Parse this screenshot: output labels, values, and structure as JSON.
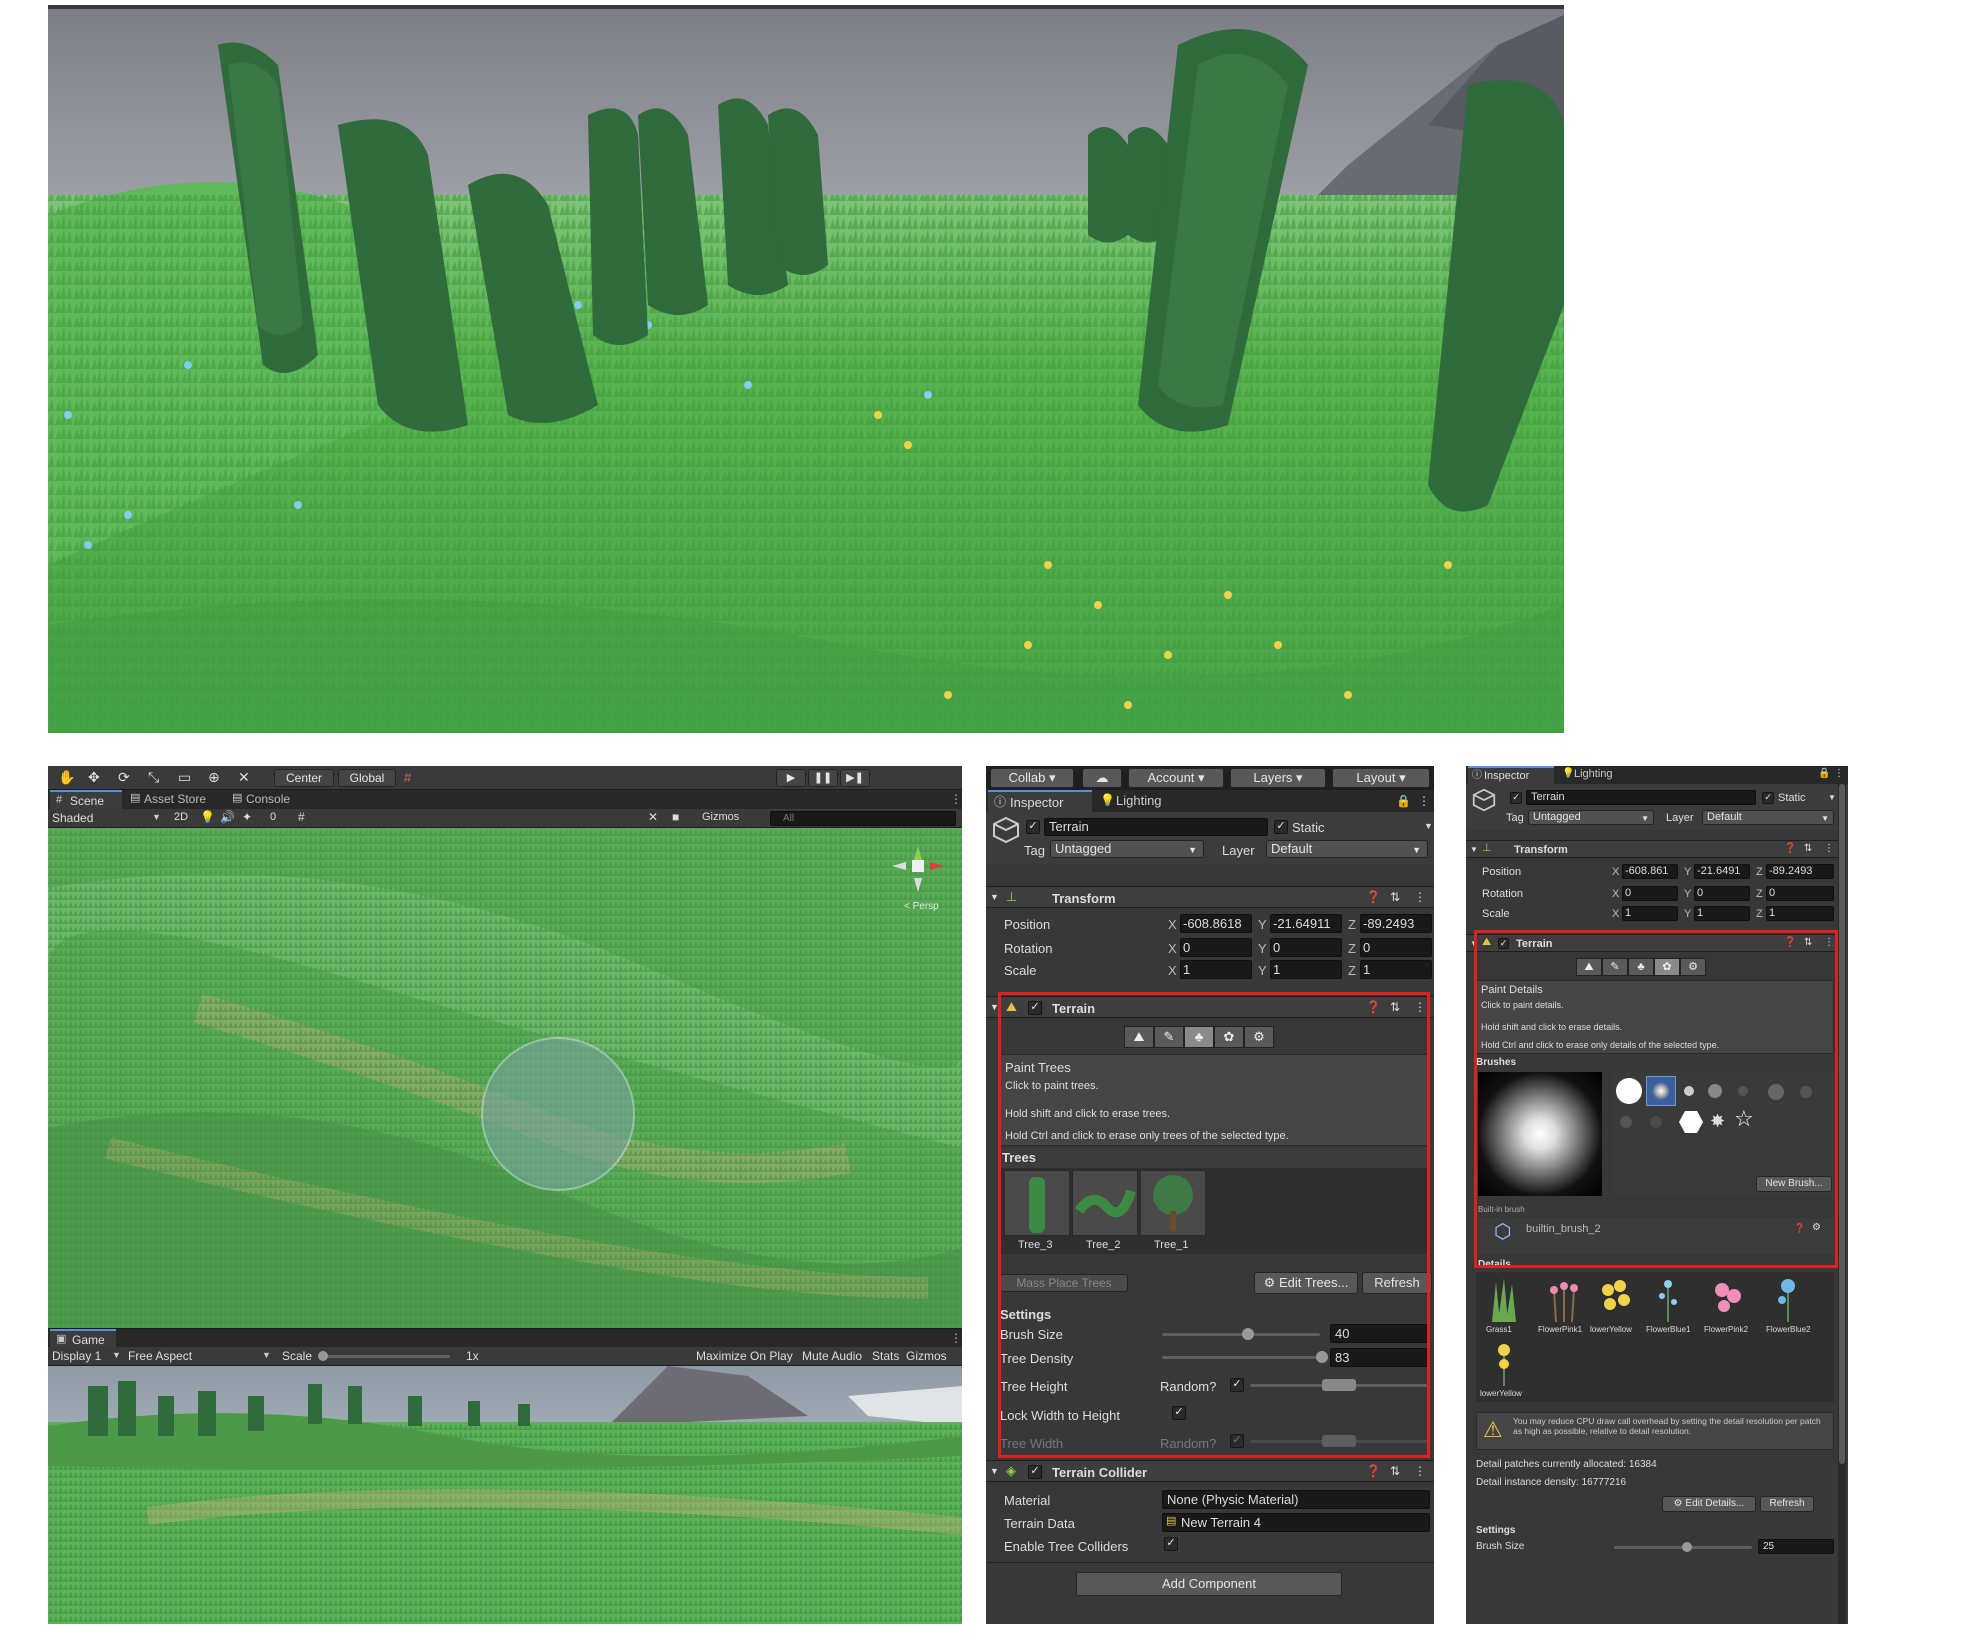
{
  "main_scene": {
    "description_hidden": ""
  },
  "editor": {
    "toolbar": {
      "center": "Center",
      "global": "Global"
    },
    "tabs": {
      "scene": "Scene",
      "asset_store": "Asset Store",
      "console": "Console"
    },
    "scene_bar": {
      "shading": "Shaded",
      "mode_2d": "2D",
      "hidden_count": "0",
      "gizmos": "Gizmos",
      "search_placeholder": "All"
    },
    "gizmo": {
      "persp": "< Persp"
    },
    "game": {
      "tab": "Game",
      "display": "Display 1",
      "aspect": "Free Aspect",
      "scale_label": "Scale",
      "scale_value": "1x",
      "maximize": "Maximize On Play",
      "mute": "Mute Audio",
      "stats": "Stats",
      "gizmos": "Gizmos"
    }
  },
  "inspector1": {
    "topbar": {
      "collab": "Collab",
      "account": "Account",
      "layers": "Layers",
      "layout": "Layout"
    },
    "tabs": {
      "inspector": "Inspector",
      "lighting": "Lighting"
    },
    "object": {
      "name": "Terrain",
      "static": "Static",
      "tag_label": "Tag",
      "tag": "Untagged",
      "layer_label": "Layer",
      "layer": "Default"
    },
    "transform": {
      "title": "Transform",
      "rows": [
        {
          "label": "Position",
          "x": "-608.8618",
          "y": "-21.64911",
          "z": "-89.2493"
        },
        {
          "label": "Rotation",
          "x": "0",
          "y": "0",
          "z": "0"
        },
        {
          "label": "Scale",
          "x": "1",
          "y": "1",
          "z": "1"
        }
      ]
    },
    "terrain": {
      "title": "Terrain",
      "help_title": "Paint Trees",
      "help_lines": [
        "Click to paint trees.",
        "Hold shift and click to erase trees.",
        "Hold Ctrl and click to erase only trees of the selected type."
      ],
      "trees_header": "Trees",
      "trees": [
        "Tree_3",
        "Tree_2",
        "Tree_1"
      ],
      "mass_place": "Mass Place Trees",
      "edit_trees": "Edit Trees...",
      "refresh": "Refresh",
      "settings_header": "Settings",
      "brush_size_label": "Brush Size",
      "brush_size": "40",
      "tree_density_label": "Tree Density",
      "tree_density": "83",
      "tree_height_label": "Tree Height",
      "random_label": "Random?",
      "lock_label": "Lock Width to Height",
      "tree_width_label": "Tree Width"
    },
    "collider": {
      "title": "Terrain Collider",
      "material_label": "Material",
      "material": "None (Physic Material)",
      "data_label": "Terrain Data",
      "data": "New Terrain 4",
      "enable_label": "Enable Tree Colliders"
    },
    "add_component": "Add Component"
  },
  "inspector2": {
    "tabs": {
      "inspector": "Inspector",
      "lighting": "Lighting"
    },
    "object": {
      "name": "Terrain",
      "static": "Static",
      "tag_label": "Tag",
      "tag": "Untagged",
      "layer_label": "Layer",
      "layer": "Default"
    },
    "transform": {
      "title": "Transform",
      "rows": [
        {
          "label": "Position",
          "x": "-608.861",
          "y": "-21.6491",
          "z": "-89.2493"
        },
        {
          "label": "Rotation",
          "x": "0",
          "y": "0",
          "z": "0"
        },
        {
          "label": "Scale",
          "x": "1",
          "y": "1",
          "z": "1"
        }
      ]
    },
    "terrain": {
      "title": "Terrain",
      "help_title": "Paint Details",
      "help_lines": [
        "Click to paint details.",
        "Hold shift and click to erase details.",
        "Hold Ctrl and click to erase only details of the selected type."
      ],
      "brushes_header": "Brushes",
      "new_brush": "New Brush...",
      "builtin_label": "Built-in brush",
      "brush_name": "builtin_brush_2",
      "details_header": "Details",
      "details": [
        "Grass1",
        "FlowerPink1",
        "lowerYellow",
        "FlowerBlue1",
        "FlowerPink2",
        "FlowerBlue2"
      ],
      "details_row2": [
        "lowerYellow"
      ],
      "warning": "You may reduce CPU draw call overhead by setting the detail resolution per patch as high as possible, relative to detail resolution.",
      "patches": "Detail patches currently allocated: 16384",
      "density": "Detail instance density: 16777216",
      "edit_details": "Edit Details...",
      "refresh": "Refresh",
      "settings_header": "Settings",
      "brush_size_label": "Brush Size",
      "brush_size": "25"
    }
  },
  "colors": {
    "highlight": "#e0201e",
    "panel": "#383838",
    "field": "#191919"
  }
}
